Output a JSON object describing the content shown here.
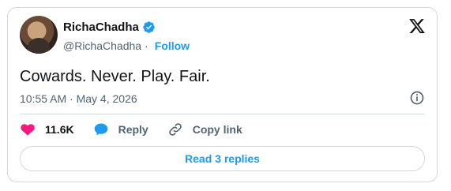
{
  "author": {
    "name": "RichaChadha",
    "handle": "@RichaChadha",
    "follow_label": "Follow",
    "verified": true
  },
  "tweet": {
    "text": "Cowards. Never. Play. Fair.",
    "timestamp": "10:55 AM · May 4, 2026"
  },
  "actions": {
    "likes": "11.6K",
    "reply_label": "Reply",
    "copy_link_label": "Copy link"
  },
  "read_replies_label": "Read 3 replies",
  "colors": {
    "accent": "#1d9bf0",
    "like": "#f91880",
    "text": "#0f1419",
    "muted": "#536471"
  },
  "icons": [
    "x-logo-icon",
    "verified-badge-icon",
    "info-icon",
    "heart-icon",
    "reply-bubble-icon",
    "link-icon"
  ]
}
